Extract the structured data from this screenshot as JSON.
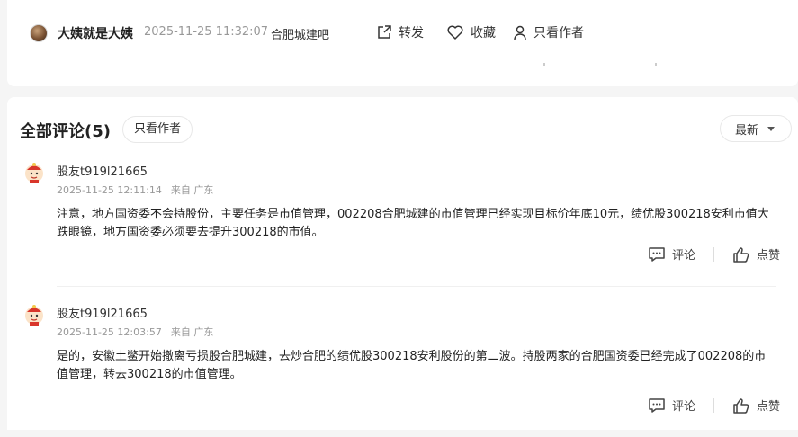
{
  "post": {
    "author": "大姨就是大姨",
    "time": "2025-11-25 11:32:07",
    "forum": "合肥城建吧",
    "actions": {
      "share": "转发",
      "favorite": "收藏",
      "only_author": "只看作者"
    }
  },
  "comments_section": {
    "title": "全部评论(5)",
    "only_author_filter": "只看作者",
    "sort": {
      "selected": "最新"
    }
  },
  "comments": [
    {
      "user": "股友t919l21665",
      "time": "2025-11-25 12:11:14",
      "location": "来自 广东",
      "text": "注意，地方国资委不会持股份，主要任务是市值管理，002208合肥城建的市值管理已经实现目标价年底10元，绩优股300218安利市值大跌眼镜，地方国资委必须要去提升300218的市值。",
      "reply_label": "评论",
      "like_label": "点赞"
    },
    {
      "user": "股友t919l21665",
      "time": "2025-11-25 12:03:57",
      "location": "来自 广东",
      "text": "是的，安徽土鳖开始撤离亏损股合肥城建，去炒合肥的绩优股300218安利股份的第二波。持股两家的合肥国资委已经完成了002208的市值管理，转去300218的市值管理。",
      "reply_label": "评论",
      "like_label": "点赞"
    }
  ]
}
